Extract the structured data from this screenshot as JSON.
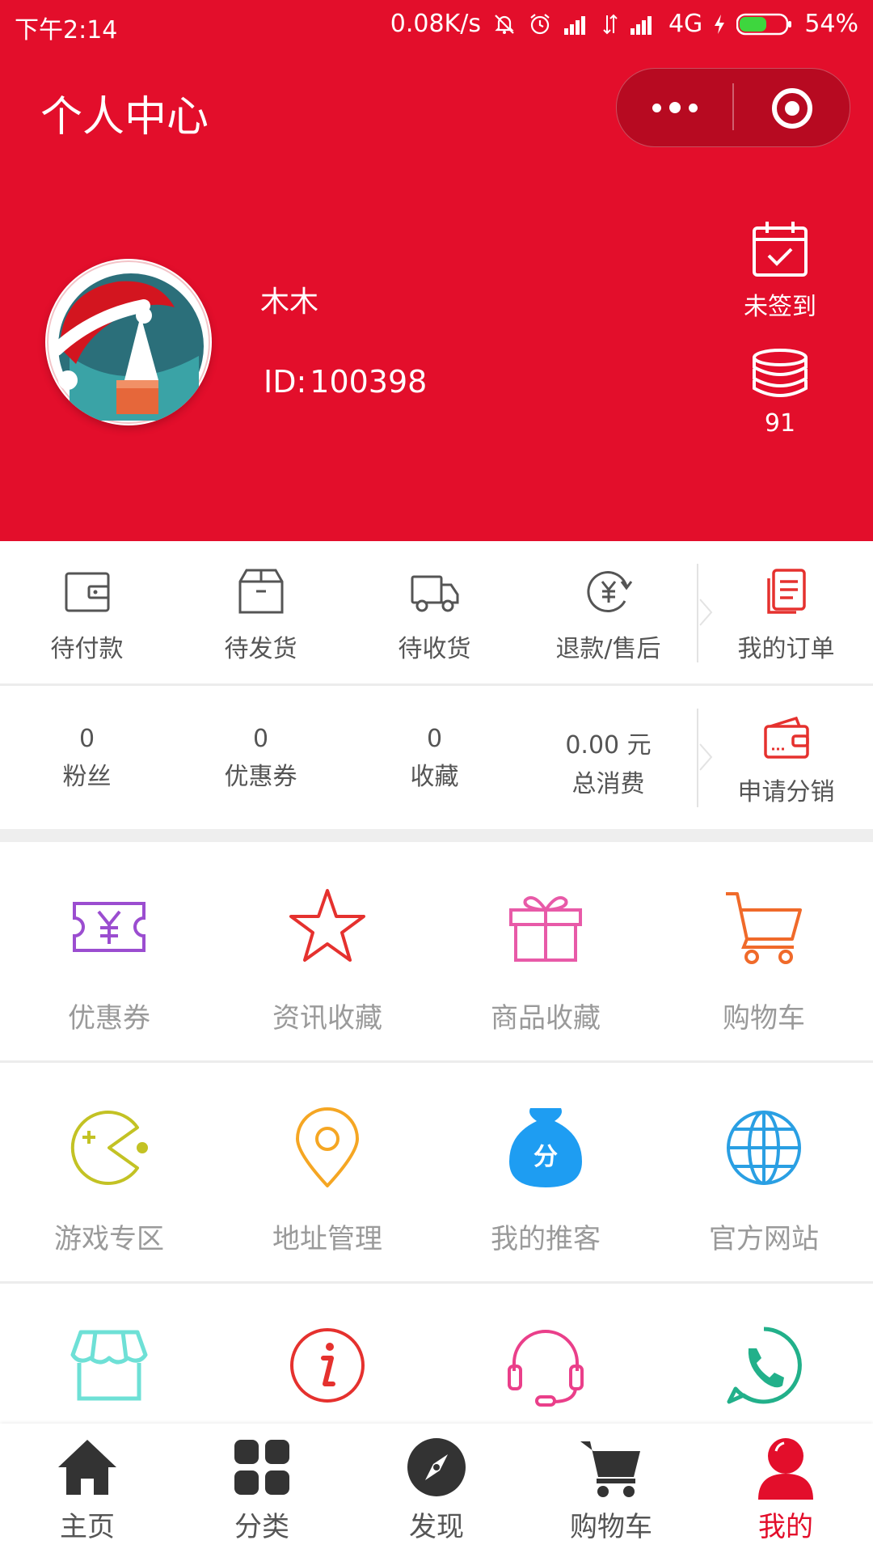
{
  "status_bar": {
    "time": "下午2:14",
    "net_speed": "0.08K/s",
    "network": "4G",
    "battery": "54%"
  },
  "header": {
    "title": "个人中心"
  },
  "user": {
    "name": "木木",
    "id_label": "ID:",
    "id_value": "100398"
  },
  "signin": {
    "label": "未签到",
    "icon": "calendar-check-icon"
  },
  "coins": {
    "value": "91",
    "icon": "coins-stack-icon"
  },
  "orders": {
    "items": [
      {
        "label": "待付款",
        "icon": "wallet-icon"
      },
      {
        "label": "待发货",
        "icon": "box-icon"
      },
      {
        "label": "待收货",
        "icon": "truck-icon"
      },
      {
        "label": "退款/售后",
        "icon": "refund-icon"
      }
    ],
    "all_label": "我的订单"
  },
  "stats": {
    "items": [
      {
        "value": "0",
        "label": "粉丝"
      },
      {
        "value": "0",
        "label": "优惠券"
      },
      {
        "value": "0",
        "label": "收藏"
      },
      {
        "value": "0.00 元",
        "label": "总消费"
      }
    ],
    "apply_label": "申请分销"
  },
  "grid": {
    "row1": [
      {
        "label": "优惠券",
        "icon": "coupon-icon",
        "color": "#9b4dd0"
      },
      {
        "label": "资讯收藏",
        "icon": "star-icon",
        "color": "#e5312e"
      },
      {
        "label": "商品收藏",
        "icon": "gift-icon",
        "color": "#e85aa8"
      },
      {
        "label": "购物车",
        "icon": "cart-icon",
        "color": "#f06a2a"
      }
    ],
    "row2": [
      {
        "label": "游戏专区",
        "icon": "pacman-icon",
        "color": "#c3c224"
      },
      {
        "label": "地址管理",
        "icon": "location-pin-icon",
        "color": "#f5a623"
      },
      {
        "label": "我的推客",
        "icon": "money-bag-icon",
        "color": "#1e9df2"
      },
      {
        "label": "官方网站",
        "icon": "globe-icon",
        "color": "#2a9fe3"
      }
    ],
    "row3": [
      {
        "icon": "store-icon",
        "color": "#6ee0d6"
      },
      {
        "icon": "info-icon",
        "color": "#e5312e"
      },
      {
        "icon": "headset-icon",
        "color": "#ea3f8a"
      },
      {
        "icon": "phone-icon",
        "color": "#22b08a"
      }
    ]
  },
  "tabbar": {
    "items": [
      {
        "label": "主页",
        "icon": "home-icon"
      },
      {
        "label": "分类",
        "icon": "grid-icon"
      },
      {
        "label": "发现",
        "icon": "compass-icon"
      },
      {
        "label": "购物车",
        "icon": "cart-icon"
      },
      {
        "label": "我的",
        "icon": "user-icon",
        "active": true
      }
    ]
  },
  "colors": {
    "brand": "#e30e2b",
    "tab_active": "#e30e2b"
  }
}
